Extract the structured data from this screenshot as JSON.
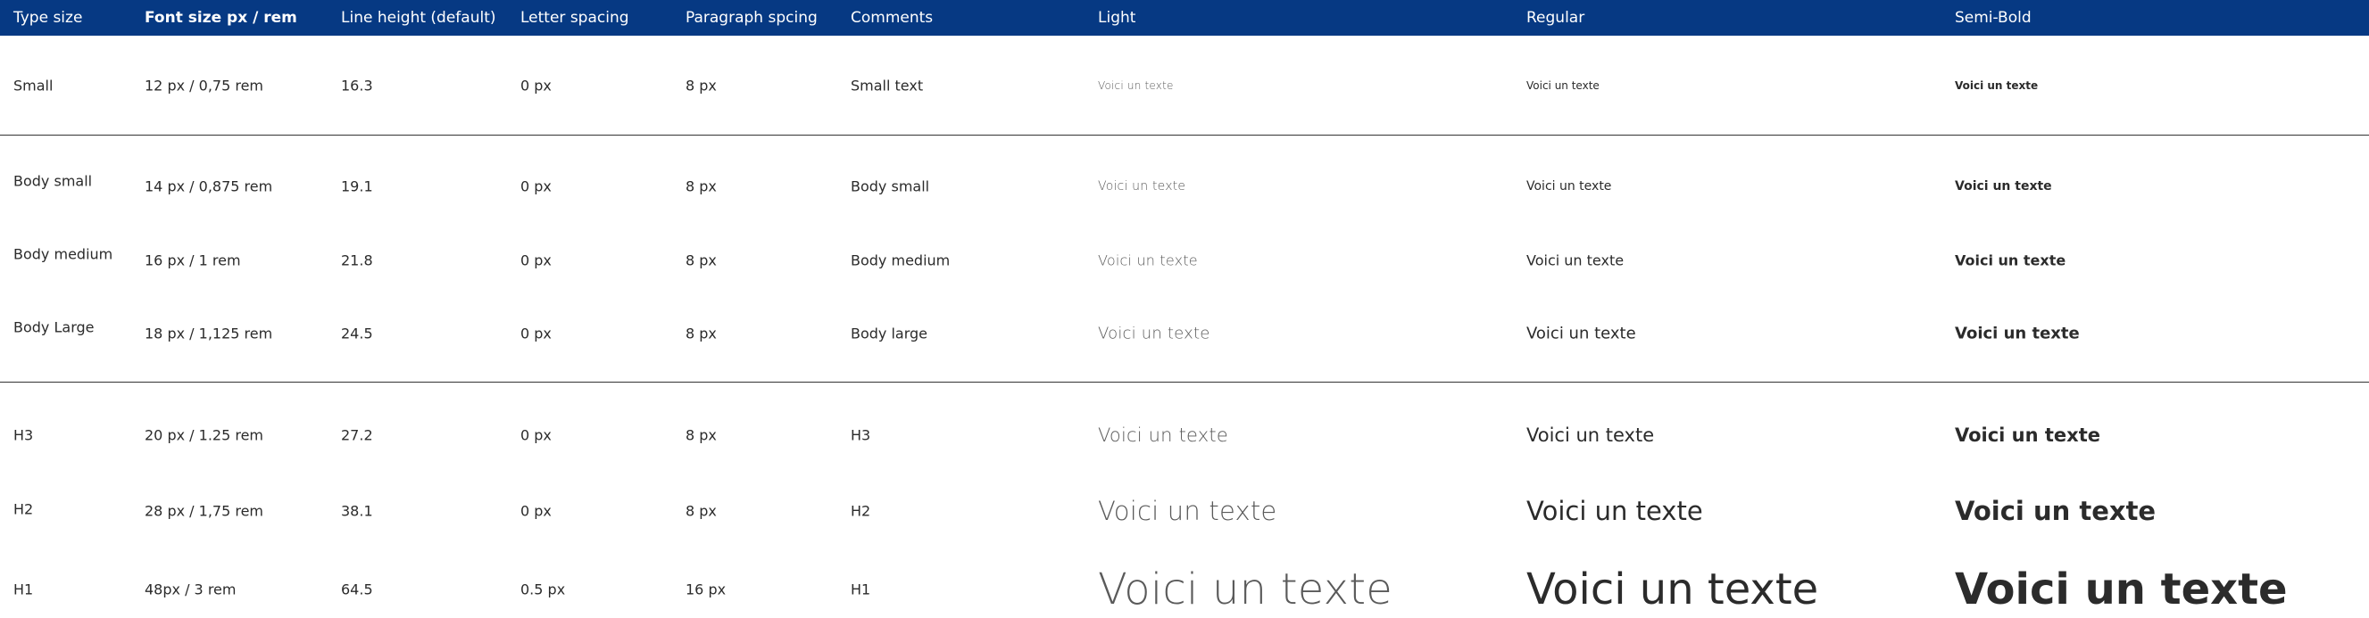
{
  "headers": {
    "type_size": "Type size",
    "font_size": "Font size px / rem",
    "line_height": "Line height (default)",
    "letter_spacing": "Letter spacing",
    "paragraph_spacing": "Paragraph spcing",
    "comments": "Comments",
    "light": "Light",
    "regular": "Regular",
    "semibold": "Semi-Bold"
  },
  "colors": {
    "header_background": "#063983",
    "header_text": "#ffffff",
    "body_text": "#2b2b2b",
    "divider": "#333333"
  },
  "rows": [
    {
      "type_size": "Small",
      "font_size": "12 px / 0,75 rem",
      "line_height": "16.3",
      "letter_spacing": "0 px",
      "paragraph_spacing": "8 px",
      "comment": "Small text",
      "sample_light": "Voici un texte",
      "sample_regular": "Voici un texte",
      "sample_semibold": "Voici un texte"
    },
    {
      "type_size": "Body small",
      "font_size": "14 px / 0,875 rem",
      "line_height": "19.1",
      "letter_spacing": "0 px",
      "paragraph_spacing": "8 px",
      "comment": "Body small",
      "sample_light": "Voici un texte",
      "sample_regular": "Voici un texte",
      "sample_semibold": "Voici un texte"
    },
    {
      "type_size": "Body medium",
      "font_size": "16 px / 1 rem",
      "line_height": "21.8",
      "letter_spacing": "0 px",
      "paragraph_spacing": "8 px",
      "comment": "Body medium",
      "sample_light": "Voici un texte",
      "sample_regular": "Voici un texte",
      "sample_semibold": "Voici un texte"
    },
    {
      "type_size": "Body Large",
      "font_size": "18 px / 1,125 rem",
      "line_height": "24.5",
      "letter_spacing": "0 px",
      "paragraph_spacing": "8 px",
      "comment": "Body large",
      "sample_light": "Voici un texte",
      "sample_regular": "Voici un texte",
      "sample_semibold": "Voici un texte"
    },
    {
      "type_size": "H3",
      "font_size": "20 px / 1.25 rem",
      "line_height": "27.2",
      "letter_spacing": "0 px",
      "paragraph_spacing": "8 px",
      "comment": "H3",
      "sample_light": "Voici un texte",
      "sample_regular": "Voici un texte",
      "sample_semibold": "Voici un texte"
    },
    {
      "type_size": "H2",
      "font_size": "28 px / 1,75 rem",
      "line_height": "38.1",
      "letter_spacing": "0 px",
      "paragraph_spacing": "8 px",
      "comment": "H2",
      "sample_light": "Voici un texte",
      "sample_regular": "Voici un texte",
      "sample_semibold": "Voici un texte"
    },
    {
      "type_size": "H1",
      "font_size": "48px / 3 rem",
      "line_height": "64.5",
      "letter_spacing": "0.5 px",
      "paragraph_spacing": "16 px",
      "comment": "H1",
      "sample_light": "Voici un texte",
      "sample_regular": "Voici un texte",
      "sample_semibold": "Voici un texte"
    }
  ]
}
